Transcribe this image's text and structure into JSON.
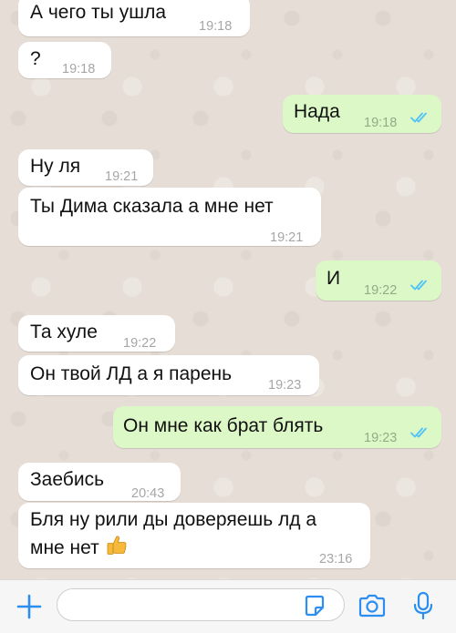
{
  "messages": [
    {
      "text": "А чего ты ушла",
      "time": "19:18",
      "direction": "incoming"
    },
    {
      "text": "?",
      "time": "19:18",
      "direction": "incoming"
    },
    {
      "text": "Нада",
      "time": "19:18",
      "direction": "outgoing",
      "status": "read"
    },
    {
      "text": "Ну ля",
      "time": "19:21",
      "direction": "incoming"
    },
    {
      "text": "Ты Дима сказала а мне нет",
      "time": "19:21",
      "direction": "incoming"
    },
    {
      "text": "И",
      "time": "19:22",
      "direction": "outgoing",
      "status": "read"
    },
    {
      "text": "Та хуле",
      "time": "19:22",
      "direction": "incoming"
    },
    {
      "text": "Он твой ЛД а я парень",
      "time": "19:23",
      "direction": "incoming"
    },
    {
      "text": "Он мне как брат блять",
      "time": "19:23",
      "direction": "outgoing",
      "status": "read"
    },
    {
      "text": "Заебись",
      "time": "20:43",
      "direction": "incoming"
    },
    {
      "text_line1": "Бля ну рили ды доверяешь лд а",
      "text_line2": "мне нет",
      "emoji": "thumbs-up",
      "time": "23:16",
      "direction": "incoming"
    }
  ],
  "composer": {
    "input_value": "",
    "placeholder": ""
  },
  "colors": {
    "incoming_bubble": "#ffffff",
    "outgoing_bubble": "#dcf8c6",
    "read_ticks": "#4fc3f7",
    "accent": "#2b8ef0",
    "wallpaper": "#e6ded6"
  },
  "icons": [
    "plus-icon",
    "sticker-icon",
    "camera-icon",
    "microphone-icon",
    "double-check-icon"
  ]
}
